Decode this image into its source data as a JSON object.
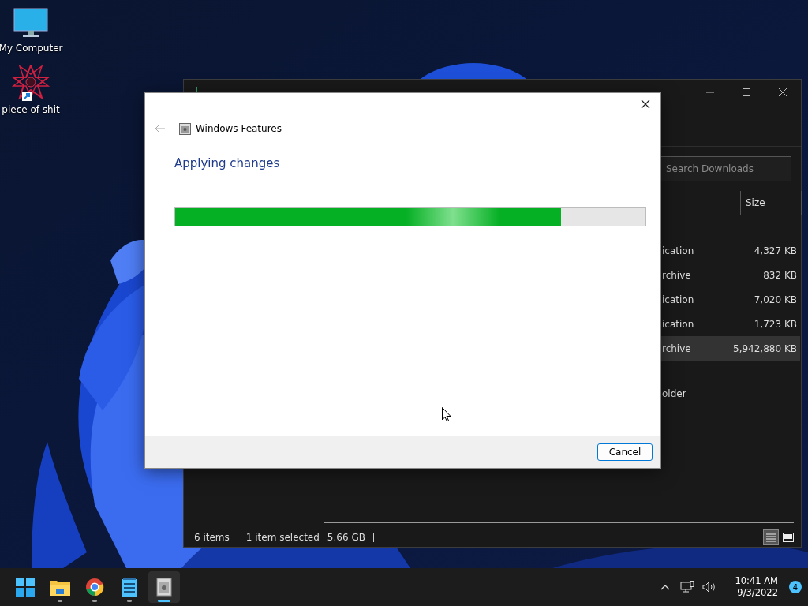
{
  "desktop": {
    "icons": [
      {
        "kind": "computer",
        "label": "My Computer"
      },
      {
        "kind": "shortcut",
        "label": "piece of shit"
      }
    ]
  },
  "explorer": {
    "search": {
      "placeholder": "Search Downloads"
    },
    "columns": [
      "Size"
    ],
    "rows": [
      {
        "type": "ication",
        "size": "4,327 KB",
        "selected": false
      },
      {
        "type": "rchive",
        "size": "832 KB",
        "selected": false
      },
      {
        "type": "ication",
        "size": "7,020 KB",
        "selected": false
      },
      {
        "type": "ication",
        "size": "1,723 KB",
        "selected": false
      },
      {
        "type": "rchive",
        "size": "5,942,880 KB",
        "selected": true
      }
    ],
    "group_row": "older",
    "status": {
      "items": "6 items",
      "selection": "1 item selected",
      "selection_size": "5.66 GB"
    },
    "views": [
      {
        "kind": "details",
        "selected": true
      },
      {
        "kind": "preview",
        "selected": false
      }
    ]
  },
  "dialog": {
    "title": "Windows Features",
    "heading": "Applying changes",
    "progress": {
      "level": 0.82
    },
    "buttons": [
      "Cancel"
    ]
  },
  "taskbar": {
    "apps": [
      {
        "kind": "start",
        "running": false,
        "active": false
      },
      {
        "kind": "folder",
        "running": true,
        "active": false
      },
      {
        "kind": "browser",
        "running": true,
        "active": false
      },
      {
        "kind": "notepad",
        "running": true,
        "active": false
      },
      {
        "kind": "features",
        "running": true,
        "active": true
      }
    ],
    "tray": {
      "time": "10:41 AM",
      "date": "9/3/2022",
      "notifications": "4"
    }
  }
}
